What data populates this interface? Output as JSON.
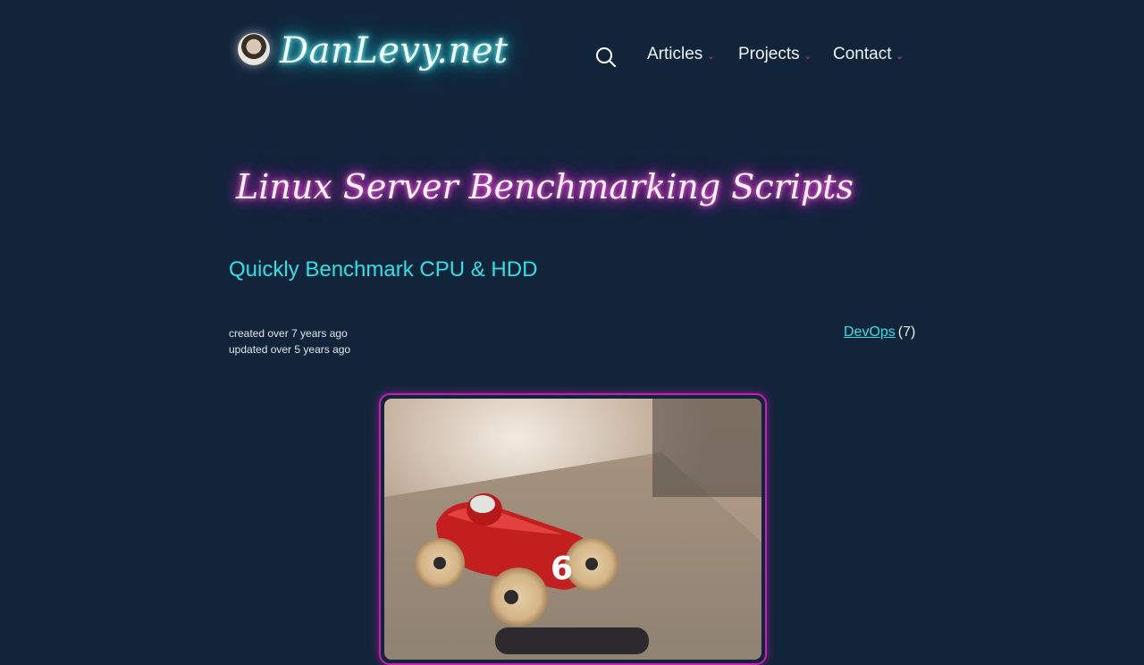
{
  "header": {
    "brand": "DanLevy.net",
    "nav": [
      {
        "label": "Articles"
      },
      {
        "label": "Projects"
      },
      {
        "label": "Contact"
      }
    ]
  },
  "article": {
    "title": "Linux Server Benchmarking Scripts",
    "subtitle": "Quickly Benchmark CPU & HDD",
    "created": "created over 7 years ago",
    "updated": "updated over 5 years ago",
    "tag": {
      "label": "DevOps",
      "count": "(7)"
    },
    "hero_number": "6"
  },
  "colors": {
    "background": "#12243a",
    "cyan_accent": "#2ee0e6",
    "magenta_accent": "#c420b4"
  },
  "icons": [
    "avatar",
    "search-icon",
    "chevron-down-icon"
  ]
}
